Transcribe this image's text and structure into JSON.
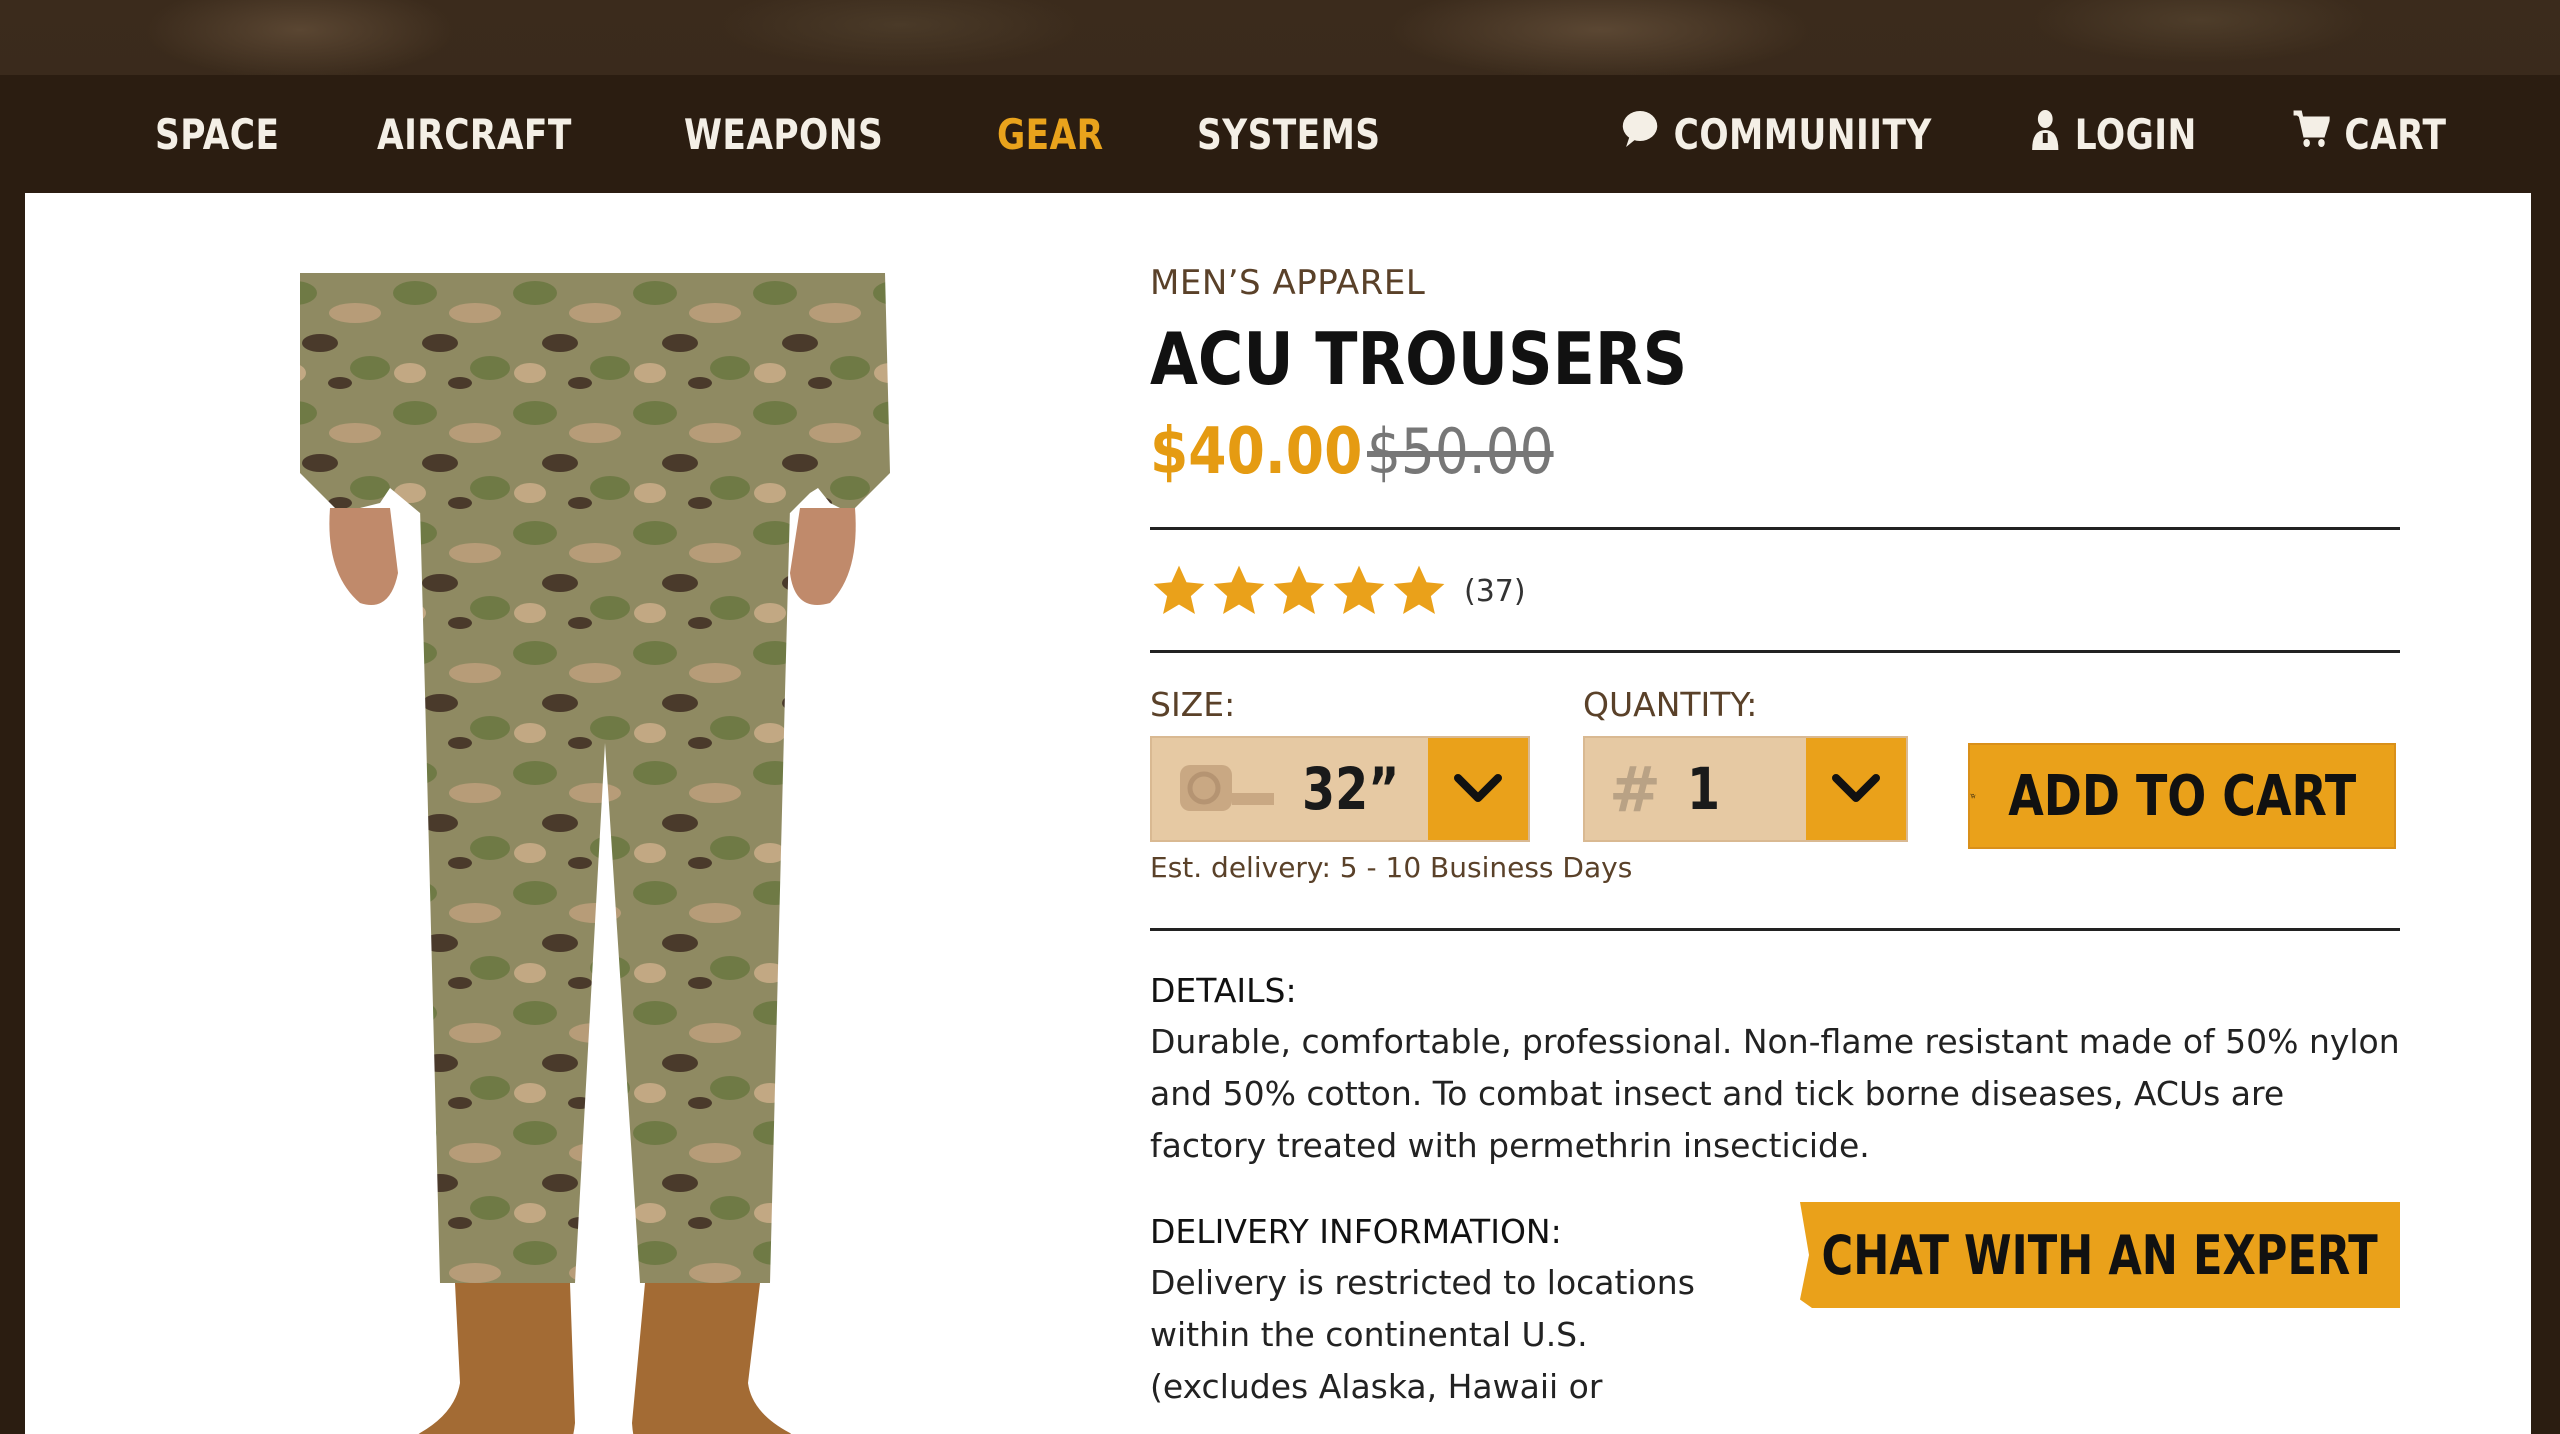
{
  "nav": {
    "left": [
      {
        "label": "SPACE",
        "active": false
      },
      {
        "label": "AIRCRAFT",
        "active": false
      },
      {
        "label": "WEAPONS",
        "active": false
      },
      {
        "label": "GEAR",
        "active": true
      },
      {
        "label": "SYSTEMS",
        "active": false
      }
    ],
    "community_label": "COMMUNIITY",
    "login_label": "LOGIN",
    "cart_label": "CART",
    "icons": {
      "community": "speech-bubble-icon",
      "login": "user-icon",
      "cart": "cart-icon"
    }
  },
  "product": {
    "category": "MEN’S APPAREL",
    "title": "ACU TROUSERS",
    "price": "$40.00",
    "old_price": "$50.00",
    "rating": {
      "stars": 5,
      "count": "(37)"
    },
    "size": {
      "label": "SIZE:",
      "value": "32”",
      "icon": "tape-measure-icon"
    },
    "quantity": {
      "label": "QUANTITY:",
      "value": "1",
      "prefix": "#"
    },
    "add_to_cart": "ADD TO CART",
    "delivery_estimate": "Est. delivery: 5 - 10 Business Days",
    "details_heading": "DETAILS:",
    "details_text": "Durable, comfortable, professional. Non-flame resistant made of 50% nylon and 50% cotton. To combat insect and tick borne diseases, ACUs are factory treated with permethrin insecticide.",
    "delivery_heading": "DELIVERY INFORMATION:",
    "delivery_text": "Delivery is restricted to locations within the continental U.S. (excludes Alaska, Hawaii or",
    "chat_button": "CHAT WITH AN EXPERT"
  },
  "colors": {
    "accent": "#eaa11a",
    "nav_bg": "#2b1d11",
    "select_bg": "#e6c9a3",
    "category_text": "#5a4129"
  }
}
